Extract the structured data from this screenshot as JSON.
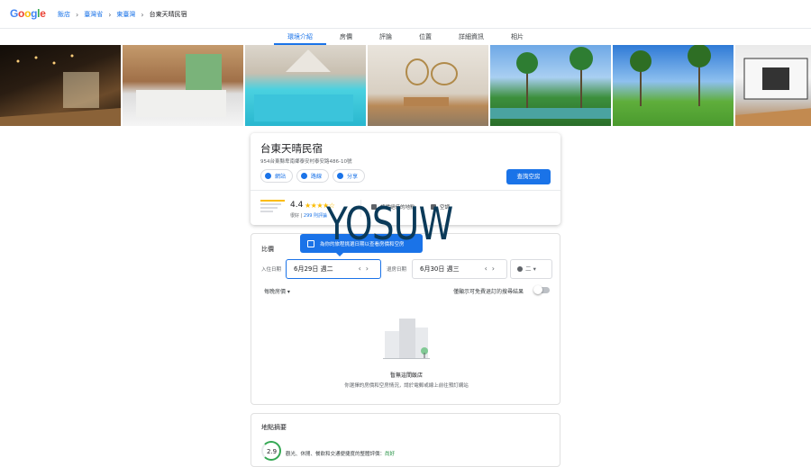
{
  "header": {
    "logo": "Google",
    "logo_colors": [
      "#4285F4",
      "#EA4335",
      "#FBBC05",
      "#4285F4",
      "#34A853",
      "#EA4335"
    ],
    "breadcrumbs": [
      "飯店",
      "臺灣省",
      "東臺灣",
      "台東天晴民宿"
    ]
  },
  "tabs": [
    {
      "label": "環境介紹",
      "active": true
    },
    {
      "label": "房價",
      "active": false
    },
    {
      "label": "評論",
      "active": false
    },
    {
      "label": "位置",
      "active": false
    },
    {
      "label": "詳細資訊",
      "active": false
    },
    {
      "label": "相片",
      "active": false
    }
  ],
  "hotel": {
    "name": "台東天晴民宿",
    "address": "954台東縣卑南鄉泰安村泰安路486-10號",
    "actions": [
      "網站",
      "路線",
      "分享"
    ],
    "book_label": "查詢空房",
    "rating": "4.4",
    "stars": "★★★★☆",
    "rating_word": "很好",
    "review_count": "299 則評論",
    "features": [
      "評價絕佳的地點",
      "空調"
    ]
  },
  "pricing": {
    "title": "比價",
    "tooltip": "為你的旅程挑選日期以查看房價和空房",
    "checkin_label": "入住日期",
    "checkin_value": "6月29日 週二",
    "checkout_label": "退房日期",
    "checkout_value": "6月30日 週三",
    "guests": "二",
    "nightly_label": "每晚房價",
    "toggle_label": "僅顯示可免費退訂的搜尋結果",
    "empty_title": "暫無這間飯店",
    "empty_subtitle": "你選擇的房價和空房情況，請於電郵或線上前往預訂網站"
  },
  "location": {
    "title": "地點摘要",
    "score": "2.9",
    "desc": "觀光、休閒、餐飲和交通便捷度的整體評價：",
    "desc_good": "尚好"
  },
  "watermark": "YOSUW",
  "colors": {
    "accent": "#1a73e8",
    "star": "#fbbc04"
  }
}
